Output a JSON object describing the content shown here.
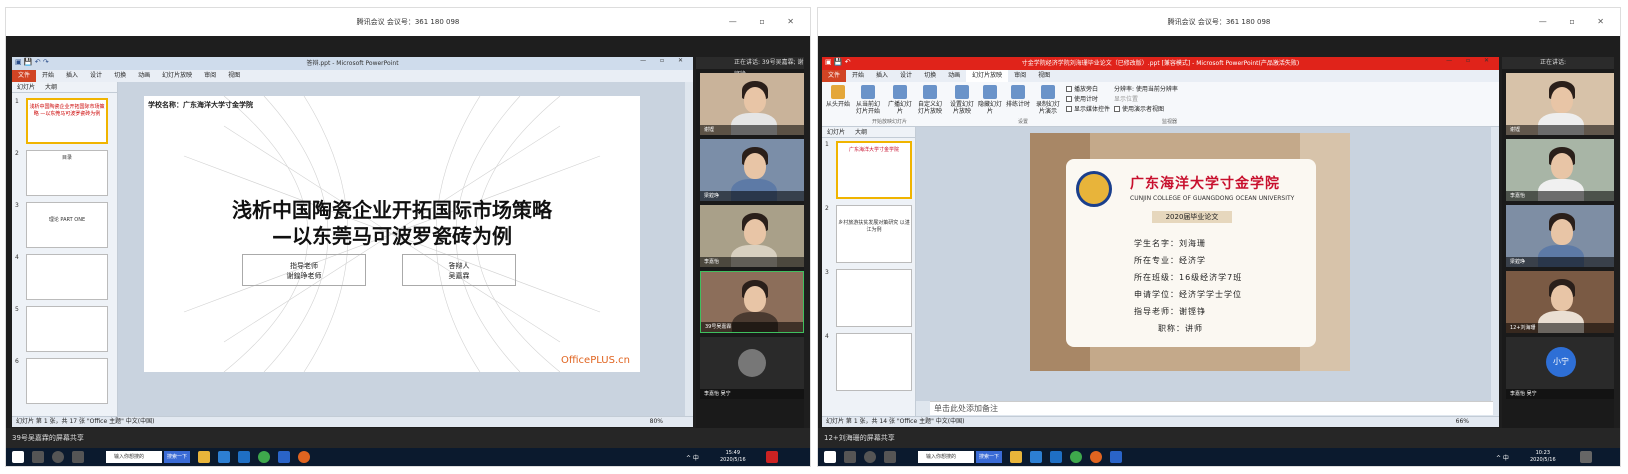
{
  "meeting_title": "腾讯会议 会议号：361 180 098",
  "left": {
    "ppt_title": "答辩.ppt - Microsoft PowerPoint",
    "menu": [
      "文件",
      "开始",
      "插入",
      "设计",
      "切换",
      "动画",
      "幻灯片放映",
      "审阅",
      "视图"
    ],
    "pane_tabs": [
      "幻灯片",
      "大纲"
    ],
    "thumbs": [
      {
        "num": "1",
        "text": "浅析中国陶瓷企业开拓国际市场策略 —以东莞马可波罗瓷砖为例"
      },
      {
        "num": "2",
        "text": "目录"
      },
      {
        "num": "3",
        "text": "理论 PART ONE"
      },
      {
        "num": "4",
        "text": ""
      },
      {
        "num": "5",
        "text": ""
      },
      {
        "num": "6",
        "text": ""
      }
    ],
    "slide": {
      "school": "学校名称：广东海洋大学寸金学院",
      "title1": "浅析中国陶瓷企业开拓国际市场策略",
      "title2": "—以东莞马可波罗瓷砖为例",
      "box1a": "指导老师",
      "box1b": "谢鍠琤老师",
      "box2a": "答辩人",
      "box2b": "吴嘉霖",
      "logo": "OfficePLUS.cn"
    },
    "status": "幻灯片 第 1 张，共 17 张   \"Office 主题\"   中文(中国)",
    "zoom": "80%",
    "vpanel_head": "正在讲话: 39号吴嘉霖; 谢铿铮",
    "tiles": [
      {
        "name": "谢铿"
      },
      {
        "name": "梁鍠琤"
      },
      {
        "name": "李嘉怡"
      },
      {
        "name": "39号吴嘉霖"
      }
    ],
    "small_tile": "李嘉怡  吴宁",
    "share": "39号吴嘉霖的屏幕共享",
    "search_ph": "输入你想搜的",
    "search_btn": "搜索一下",
    "clock_time": "15:49",
    "clock_date": "2020/5/16",
    "tray": "^ 中"
  },
  "right": {
    "ppt_title": "寸金学院经济学院刘海珊毕业论文（已修改版）.ppt [兼容模式] - Microsoft PowerPoint(产品激活失败)",
    "menu": [
      "文件",
      "开始",
      "插入",
      "设计",
      "切换",
      "动画",
      "幻灯片放映",
      "审阅",
      "视图"
    ],
    "ribbon": {
      "b1": "从头开始",
      "b2": "从当前幻灯片开始",
      "b3": "广播幻灯片",
      "b4": "自定义幻灯片放映",
      "b5": "设置幻灯片放映",
      "b6": "隐藏幻灯片",
      "b7": "排练计时",
      "b8": "录制幻灯片演示",
      "c1": "播放旁白",
      "c2": "使用计时",
      "c3": "显示媒体控件",
      "m1": "分辨率:  使用当前分辨率",
      "m2": "显示位置",
      "m3": "使用演示者视图",
      "g1": "开始放映幻灯片",
      "g2": "设置",
      "g3": "监视器"
    },
    "pane_tabs": [
      "幻灯片",
      "大纲"
    ],
    "thumbs": [
      {
        "num": "1",
        "text": "广东海洋大学寸金学院"
      },
      {
        "num": "2",
        "text": "乡村旅游扶贫发展对策研究 以湛江为例"
      },
      {
        "num": "3",
        "text": ""
      },
      {
        "num": "4",
        "text": ""
      }
    ],
    "slide": {
      "school_cn": "广东海洋大学寸金学院",
      "school_en": "CUNJIN COLLEGE OF GUANGDONG OCEAN UNIVERSITY",
      "badge": "2020届毕业论文",
      "rows": [
        "学生名字：刘海珊",
        "所在专业：经济学",
        "所在班级：16级经济学7班",
        "申请学位：经济学学士学位",
        "指导老师：谢铿铮",
        "职称：讲师"
      ]
    },
    "notes": "单击此处添加备注",
    "status": "幻灯片 第 1 张，共 14 张   \"Office 主题\"   中文(中国)",
    "zoom": "66%",
    "vpanel_head": "正在讲话:",
    "tiles": [
      {
        "name": "谢铿"
      },
      {
        "name": "李嘉怡"
      },
      {
        "name": "梁鍠琤"
      },
      {
        "name": "12+刘海珊"
      }
    ],
    "avatar": "小宁",
    "small_tile": "李嘉怡  吴宁",
    "share": "12+刘海珊的屏幕共享",
    "search_ph": "输入你想搜的",
    "search_btn": "搜索一下",
    "clock_time": "10:23",
    "clock_date": "2020/5/16",
    "tray": "^ 中"
  },
  "colors": {
    "ppt_red": "#e0231a",
    "slide_title": "#111111",
    "school_red": "#c8102e",
    "taskbar": "#0b1a2e"
  }
}
